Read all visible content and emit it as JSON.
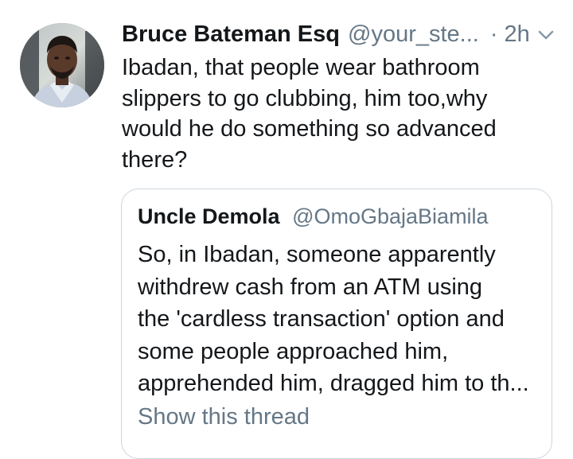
{
  "tweet": {
    "author_name": "Bruce Bateman Esq",
    "author_handle": "@your_ste...",
    "time": "· 2h",
    "text": "Ibadan, that people wear bathroom slippers to go clubbing, him too,why would he do something so advanced there?",
    "menu_icon": "chevron-down-icon",
    "avatar_icon": "profile-photo"
  },
  "quoted_tweet": {
    "author_name": "Uncle Demola",
    "author_handle": "@OmoGbajaBiamila",
    "text_lines": [
      "So, in Ibadan, someone apparently",
      "withdrew cash from an ATM using",
      "the 'cardless transaction' option and",
      "some people approached him,",
      "apprehended him, dragged him to th..."
    ],
    "show_thread_label": "Show this thread"
  },
  "colors": {
    "text_primary": "#14171a",
    "text_secondary": "#657786",
    "border": "#ccd6dd"
  }
}
